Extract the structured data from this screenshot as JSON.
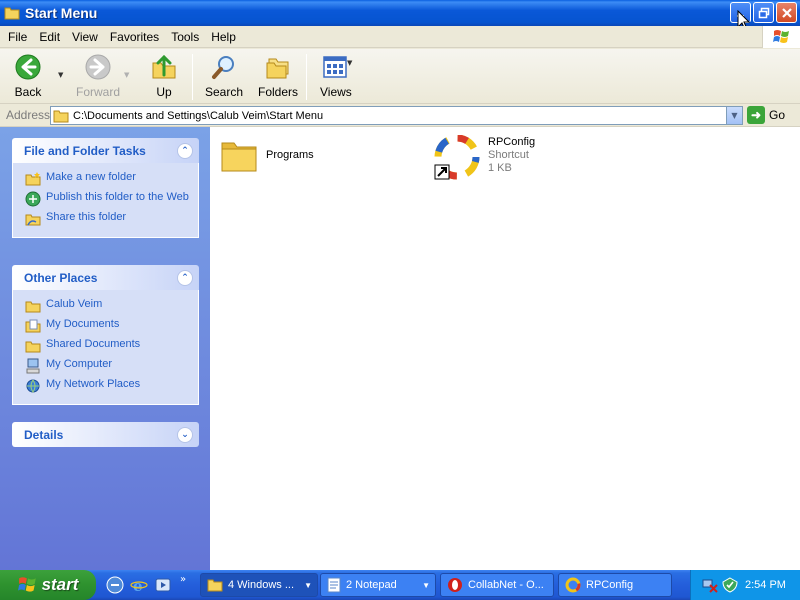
{
  "window": {
    "title": "Start Menu"
  },
  "menubar": [
    "File",
    "Edit",
    "View",
    "Favorites",
    "Tools",
    "Help"
  ],
  "toolbar": {
    "back": "Back",
    "forward": "Forward",
    "up": "Up",
    "search": "Search",
    "folders": "Folders",
    "views": "Views"
  },
  "address": {
    "label": "Address",
    "value": "C:\\Documents and Settings\\Calub Veim\\Start Menu",
    "go": "Go"
  },
  "taskpane": {
    "file_tasks": {
      "title": "File and Folder Tasks",
      "items": [
        "Make a new folder",
        "Publish this folder to the Web",
        "Share this folder"
      ]
    },
    "other_places": {
      "title": "Other Places",
      "items": [
        "Calub Veim",
        "My Documents",
        "Shared Documents",
        "My Computer",
        "My Network Places"
      ]
    },
    "details": {
      "title": "Details"
    }
  },
  "files": [
    {
      "name": "Programs"
    },
    {
      "name": "RPConfig",
      "type": "Shortcut",
      "size": "1 KB"
    }
  ],
  "taskbar": {
    "start": "start",
    "tasks": [
      "4 Windows ...",
      "2 Notepad",
      "CollabNet - O...",
      "RPConfig"
    ],
    "clock": "2:54 PM"
  },
  "colors": {
    "title_bar": "#0a58d8",
    "task_link": "#215dc6",
    "taskbar": "#245edb",
    "start_button": "#2f932f"
  }
}
